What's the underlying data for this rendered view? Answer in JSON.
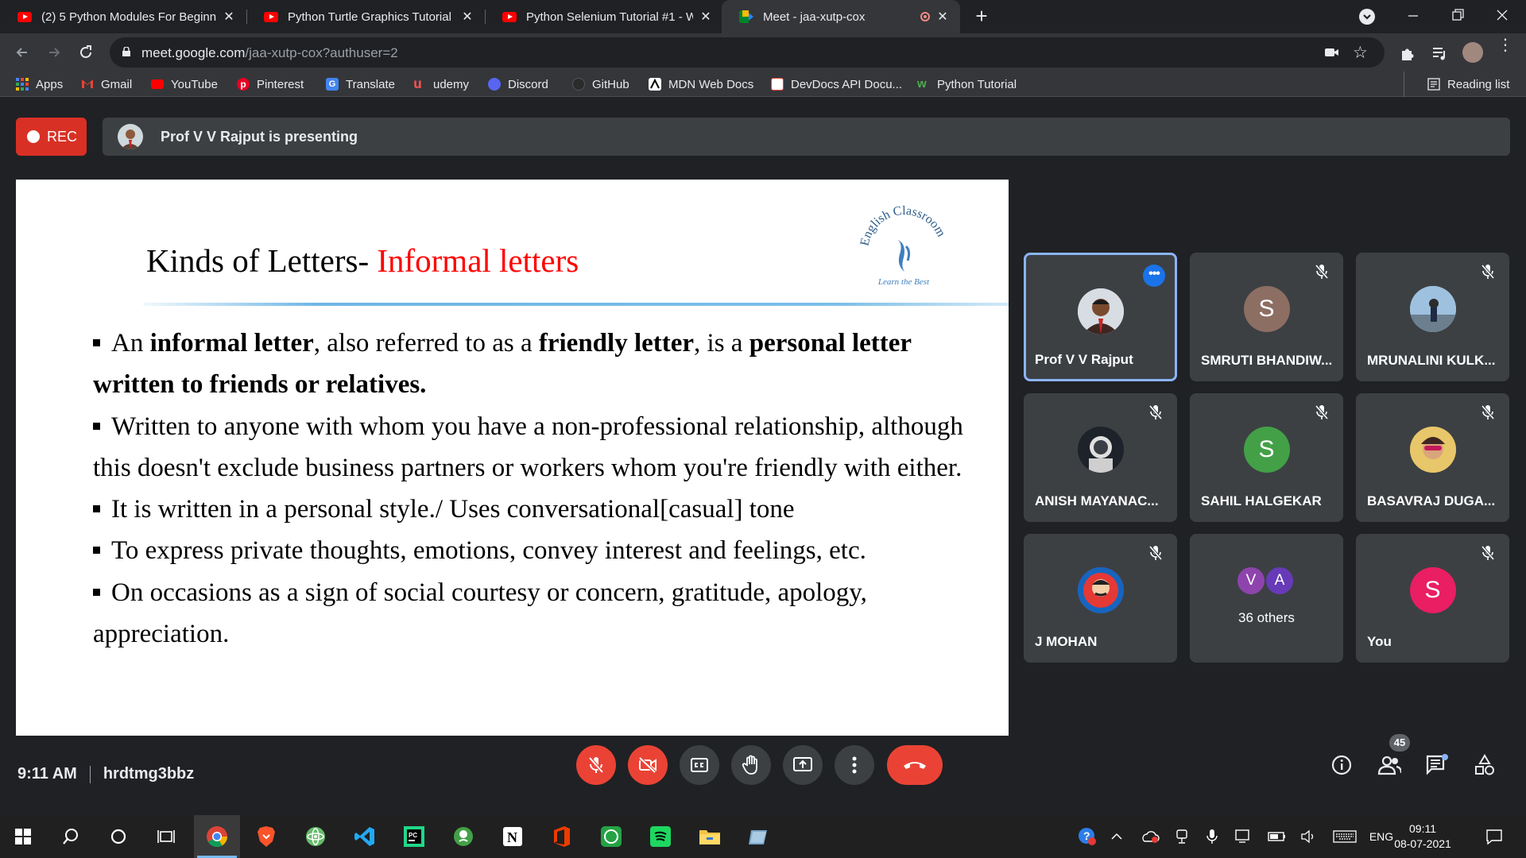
{
  "browser": {
    "tabs": [
      {
        "title": "(2) 5 Python Modules For Beginn",
        "active": false
      },
      {
        "title": "Python Turtle Graphics Tutorial #",
        "active": false
      },
      {
        "title": "Python Selenium Tutorial #1 - W",
        "active": false
      },
      {
        "title": "Meet - jaa-xutp-cox",
        "active": true
      }
    ],
    "url_host": "meet.google.com",
    "url_path": "/jaa-xutp-cox?authuser=2",
    "bookmarks": [
      "Apps",
      "Gmail",
      "YouTube",
      "Pinterest",
      "Translate",
      "udemy",
      "Discord",
      "GitHub",
      "MDN Web Docs",
      "DevDocs API Docu...",
      "Python Tutorial"
    ],
    "reading_list": "Reading list"
  },
  "meet": {
    "rec_label": "REC",
    "presenting_text": "Prof V V Rajput is presenting",
    "slide": {
      "title_black": "Kinds of Letters-",
      "title_red": "Informal  letters",
      "logo_text_top": "English Classroom",
      "logo_text_bottom": "Learn the Best",
      "bullets": [
        {
          "parts": [
            {
              "t": "An ",
              "b": false
            },
            {
              "t": "informal letter",
              "b": true
            },
            {
              "t": ", also referred to as a ",
              "b": false
            },
            {
              "t": "friendly letter",
              "b": true
            },
            {
              "t": ", is a ",
              "b": false
            },
            {
              "t": "personal letter written to friends or relatives.",
              "b": true
            }
          ]
        },
        {
          "parts": [
            {
              "t": "Written to anyone with whom you have a non-professional relationship, although this doesn't exclude business partners or workers whom you're friendly with either.",
              "b": false
            }
          ]
        },
        {
          "parts": [
            {
              "t": "It is written in a personal style./ Uses conversational[casual] tone",
              "b": false
            }
          ]
        },
        {
          "parts": [
            {
              "t": "To express private thoughts, emotions, convey  interest and feelings, etc.",
              "b": false
            }
          ]
        },
        {
          "parts": [
            {
              "t": "On occasions as a sign of social courtesy or concern, gratitude, apology, appreciation.",
              "b": false
            }
          ]
        }
      ]
    },
    "participants": [
      {
        "name": "Prof V V Rajput",
        "initial": "",
        "color": "#8d6e63",
        "speaking": true,
        "muted": false
      },
      {
        "name": "SMRUTI BHANDIW...",
        "initial": "S",
        "color": "#8d6e63",
        "speaking": false,
        "muted": true
      },
      {
        "name": "MRUNALINI KULK...",
        "initial": "",
        "color": "#9fb4c9",
        "speaking": false,
        "muted": true
      },
      {
        "name": "ANISH MAYANAC...",
        "initial": "",
        "color": "#2b2f36",
        "speaking": false,
        "muted": true
      },
      {
        "name": "SAHIL HALGEKAR",
        "initial": "S",
        "color": "#43a047",
        "speaking": false,
        "muted": true
      },
      {
        "name": "BASAVRAJ DUGA...",
        "initial": "",
        "color": "#c8a24a",
        "speaking": false,
        "muted": true
      },
      {
        "name": "J MOHAN",
        "initial": "",
        "color": "#d32f2f",
        "speaking": false,
        "muted": true
      },
      {
        "name": "You",
        "initial": "S",
        "color": "#e91e63",
        "speaking": false,
        "muted": true
      }
    ],
    "others": {
      "label": "36 others",
      "avatars": [
        {
          "initial": "V",
          "color": "#8e44ad"
        },
        {
          "initial": "A",
          "color": "#673ab7"
        }
      ]
    },
    "time": "9:11 AM",
    "meeting_code": "hrdtmg3bbz",
    "people_count": "45"
  },
  "taskbar": {
    "language": "ENG",
    "time": "09:11",
    "date": "08-07-2021"
  }
}
